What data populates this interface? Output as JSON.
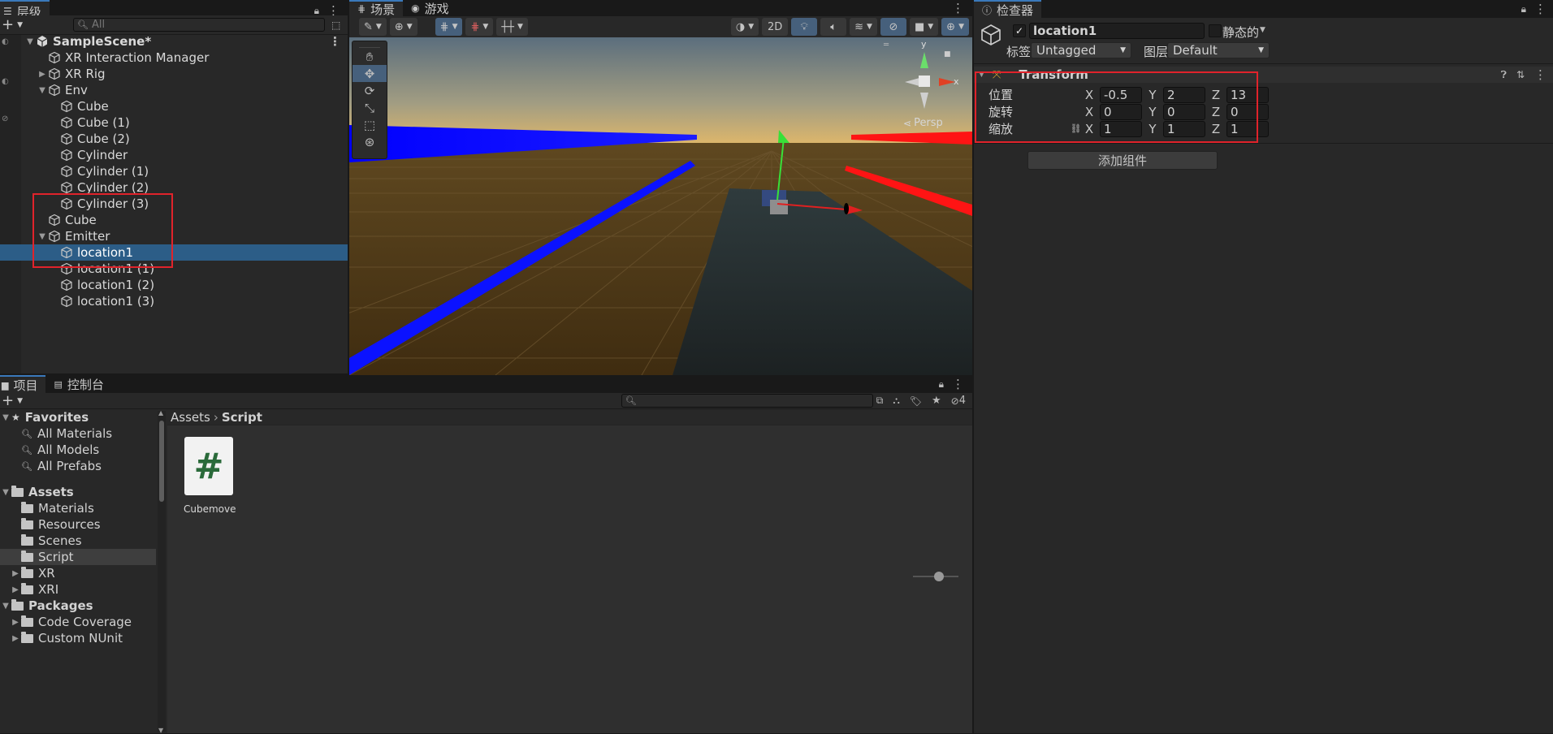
{
  "hierarchy": {
    "tab_label": "层级",
    "search_placeholder": "All",
    "scene_name": "SampleScene*",
    "items": [
      {
        "label": "XR Interaction Manager",
        "depth": 1,
        "arrow": "",
        "selected": false
      },
      {
        "label": "XR Rig",
        "depth": 1,
        "arrow": "right",
        "selected": false
      },
      {
        "label": "Env",
        "depth": 1,
        "arrow": "down",
        "selected": false
      },
      {
        "label": "Cube",
        "depth": 2,
        "arrow": "",
        "selected": false
      },
      {
        "label": "Cube (1)",
        "depth": 2,
        "arrow": "",
        "selected": false
      },
      {
        "label": "Cube (2)",
        "depth": 2,
        "arrow": "",
        "selected": false
      },
      {
        "label": "Cylinder",
        "depth": 2,
        "arrow": "",
        "selected": false
      },
      {
        "label": "Cylinder (1)",
        "depth": 2,
        "arrow": "",
        "selected": false
      },
      {
        "label": "Cylinder (2)",
        "depth": 2,
        "arrow": "",
        "selected": false
      },
      {
        "label": "Cylinder (3)",
        "depth": 2,
        "arrow": "",
        "selected": false
      },
      {
        "label": "Cube",
        "depth": 1,
        "arrow": "",
        "selected": false
      },
      {
        "label": "Emitter",
        "depth": 1,
        "arrow": "down",
        "selected": false
      },
      {
        "label": "location1",
        "depth": 2,
        "arrow": "",
        "selected": true
      },
      {
        "label": "location1 (1)",
        "depth": 2,
        "arrow": "",
        "selected": false
      },
      {
        "label": "location1 (2)",
        "depth": 2,
        "arrow": "",
        "selected": false
      },
      {
        "label": "location1 (3)",
        "depth": 2,
        "arrow": "",
        "selected": false
      }
    ]
  },
  "scene_view": {
    "tab_scene": "场景",
    "tab_game": "游戏",
    "btn_2d": "2D",
    "persp_label": "Persp",
    "gizmo_y": "y",
    "gizmo_x": "x"
  },
  "inspector": {
    "tab_label": "检查器",
    "object_name": "location1",
    "static_label": "静态的",
    "tag_label": "标签",
    "tag_value": "Untagged",
    "layer_label": "图层",
    "layer_value": "Default",
    "component_title": "Transform",
    "position_label": "位置",
    "rotation_label": "旋转",
    "scale_label": "缩放",
    "axis_x": "X",
    "axis_y": "Y",
    "axis_z": "Z",
    "position": {
      "x": "-0.5",
      "y": "2",
      "z": "13"
    },
    "rotation": {
      "x": "0",
      "y": "0",
      "z": "0"
    },
    "scale": {
      "x": "1",
      "y": "1",
      "z": "1"
    },
    "add_component": "添加组件"
  },
  "project": {
    "tab_project": "项目",
    "tab_console": "控制台",
    "hidden_count": "4",
    "breadcrumb_root": "Assets",
    "breadcrumb_current": "Script",
    "favorites_label": "Favorites",
    "favorites": [
      "All Materials",
      "All Models",
      "All Prefabs"
    ],
    "assets_label": "Assets",
    "asset_folders": [
      {
        "label": "Materials",
        "arrow": false,
        "selected": false
      },
      {
        "label": "Resources",
        "arrow": false,
        "selected": false
      },
      {
        "label": "Scenes",
        "arrow": false,
        "selected": false
      },
      {
        "label": "Script",
        "arrow": false,
        "selected": true
      },
      {
        "label": "XR",
        "arrow": true,
        "selected": false
      },
      {
        "label": "XRI",
        "arrow": true,
        "selected": false
      }
    ],
    "packages_label": "Packages",
    "package_folders": [
      "Code Coverage",
      "Custom NUnit"
    ],
    "files": [
      {
        "name": "Cubemove",
        "glyph": "#"
      }
    ]
  },
  "colors": {
    "selection": "#2c5d87",
    "accent": "#3a79bb",
    "highlight": "#e0232b"
  }
}
